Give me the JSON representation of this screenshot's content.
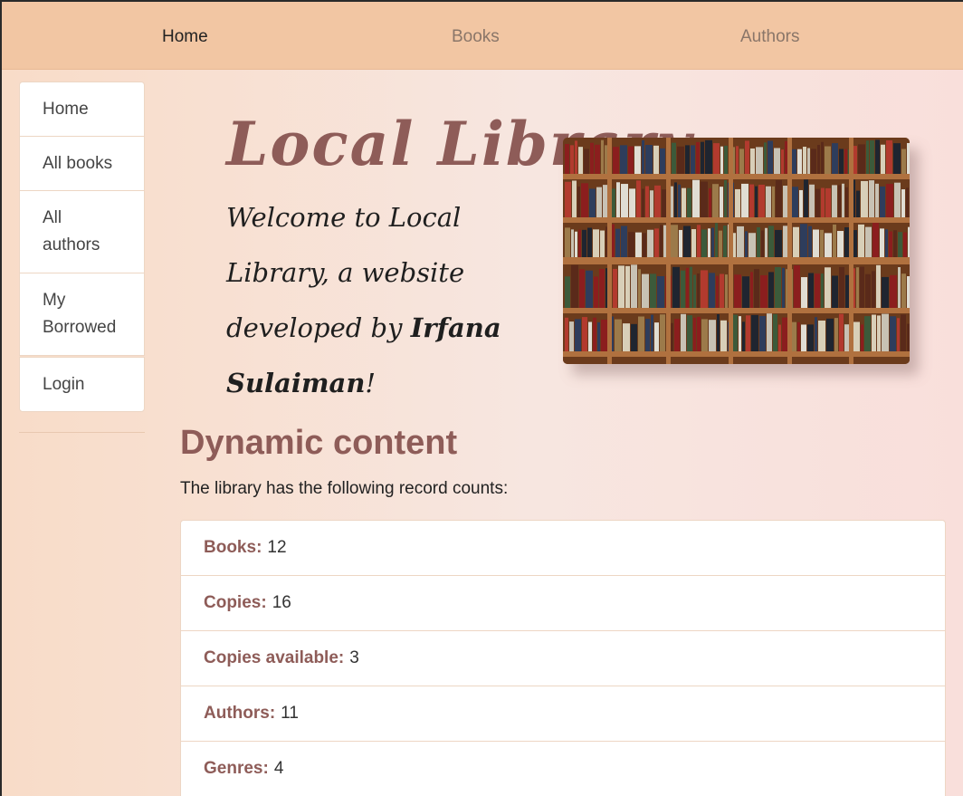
{
  "topnav": {
    "items": [
      "Home",
      "Books",
      "Authors"
    ]
  },
  "sidebar": {
    "items": [
      {
        "label": "Home"
      },
      {
        "label": "All books"
      },
      {
        "label": "All\nauthors"
      },
      {
        "label": "My\nBorrowed"
      },
      {
        "label": "Login"
      }
    ]
  },
  "hero": {
    "title": "Local Library",
    "welcome": "Welcome to Local Library, a website developed by",
    "author": "Irfana Sulaiman",
    "suffix": "!"
  },
  "dynamic": {
    "title": "Dynamic content",
    "subtitle": "The library has the following record counts:",
    "counts": [
      {
        "label": "Books:",
        "value": "12"
      },
      {
        "label": "Copies:",
        "value": "16"
      },
      {
        "label": "Copies available:",
        "value": "3"
      },
      {
        "label": "Authors:",
        "value": "11"
      },
      {
        "label": "Genres:",
        "value": "4"
      }
    ]
  },
  "colors": {
    "accent": "#8e5c58",
    "nav_bg": "#f2c6a3"
  }
}
